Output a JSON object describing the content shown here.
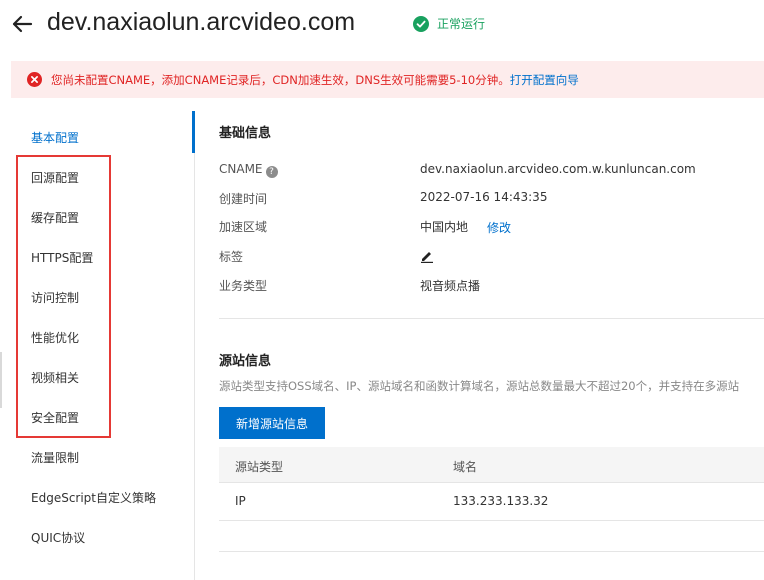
{
  "header": {
    "domain": "dev.naxiaolun.arcvideo.com",
    "status": "正常运行",
    "colors": {
      "status": "#19a15f"
    }
  },
  "alert": {
    "message": "您尚未配置CNAME，添加CNAME记录后，CDN加速生效，DNS生效可能需要5-10分钟。",
    "link": "打开配置向导",
    "colors": {
      "text": "#e02424",
      "background": "#fdecec"
    }
  },
  "sidebar": {
    "items": [
      {
        "label": "基本配置",
        "active": true
      },
      {
        "label": "回源配置"
      },
      {
        "label": "缓存配置"
      },
      {
        "label": "HTTPS配置"
      },
      {
        "label": "访问控制"
      },
      {
        "label": "性能优化"
      },
      {
        "label": "视频相关"
      },
      {
        "label": "安全配置"
      },
      {
        "label": "流量限制"
      },
      {
        "label": "EdgeScript自定义策略"
      },
      {
        "label": "QUIC协议"
      }
    ],
    "accent": "#0070cc"
  },
  "basic_info": {
    "title": "基础信息",
    "rows": [
      {
        "label": "CNAME",
        "value": "dev.naxiaolun.arcvideo.com.w.kunluncan.com"
      },
      {
        "label": "创建时间",
        "value": "2022-07-16 14:43:35"
      },
      {
        "label": "加速区域",
        "value": "中国内地",
        "action": "修改"
      },
      {
        "label": "标签"
      },
      {
        "label": "业务类型",
        "value": "视音频点播"
      }
    ]
  },
  "origin_info": {
    "title": "源站信息",
    "description": "源站类型支持OSS域名、IP、源站域名和函数计算域名，源站总数量最大不超过20个，并支持在多源站",
    "add_button": "新增源站信息",
    "table": {
      "columns": [
        "源站类型",
        "域名"
      ],
      "rows": [
        [
          "IP",
          "133.233.133.32"
        ]
      ]
    }
  },
  "icons": [
    "back-arrow-icon",
    "check-circle-icon",
    "error-circle-icon",
    "help-icon",
    "edit-icon"
  ]
}
